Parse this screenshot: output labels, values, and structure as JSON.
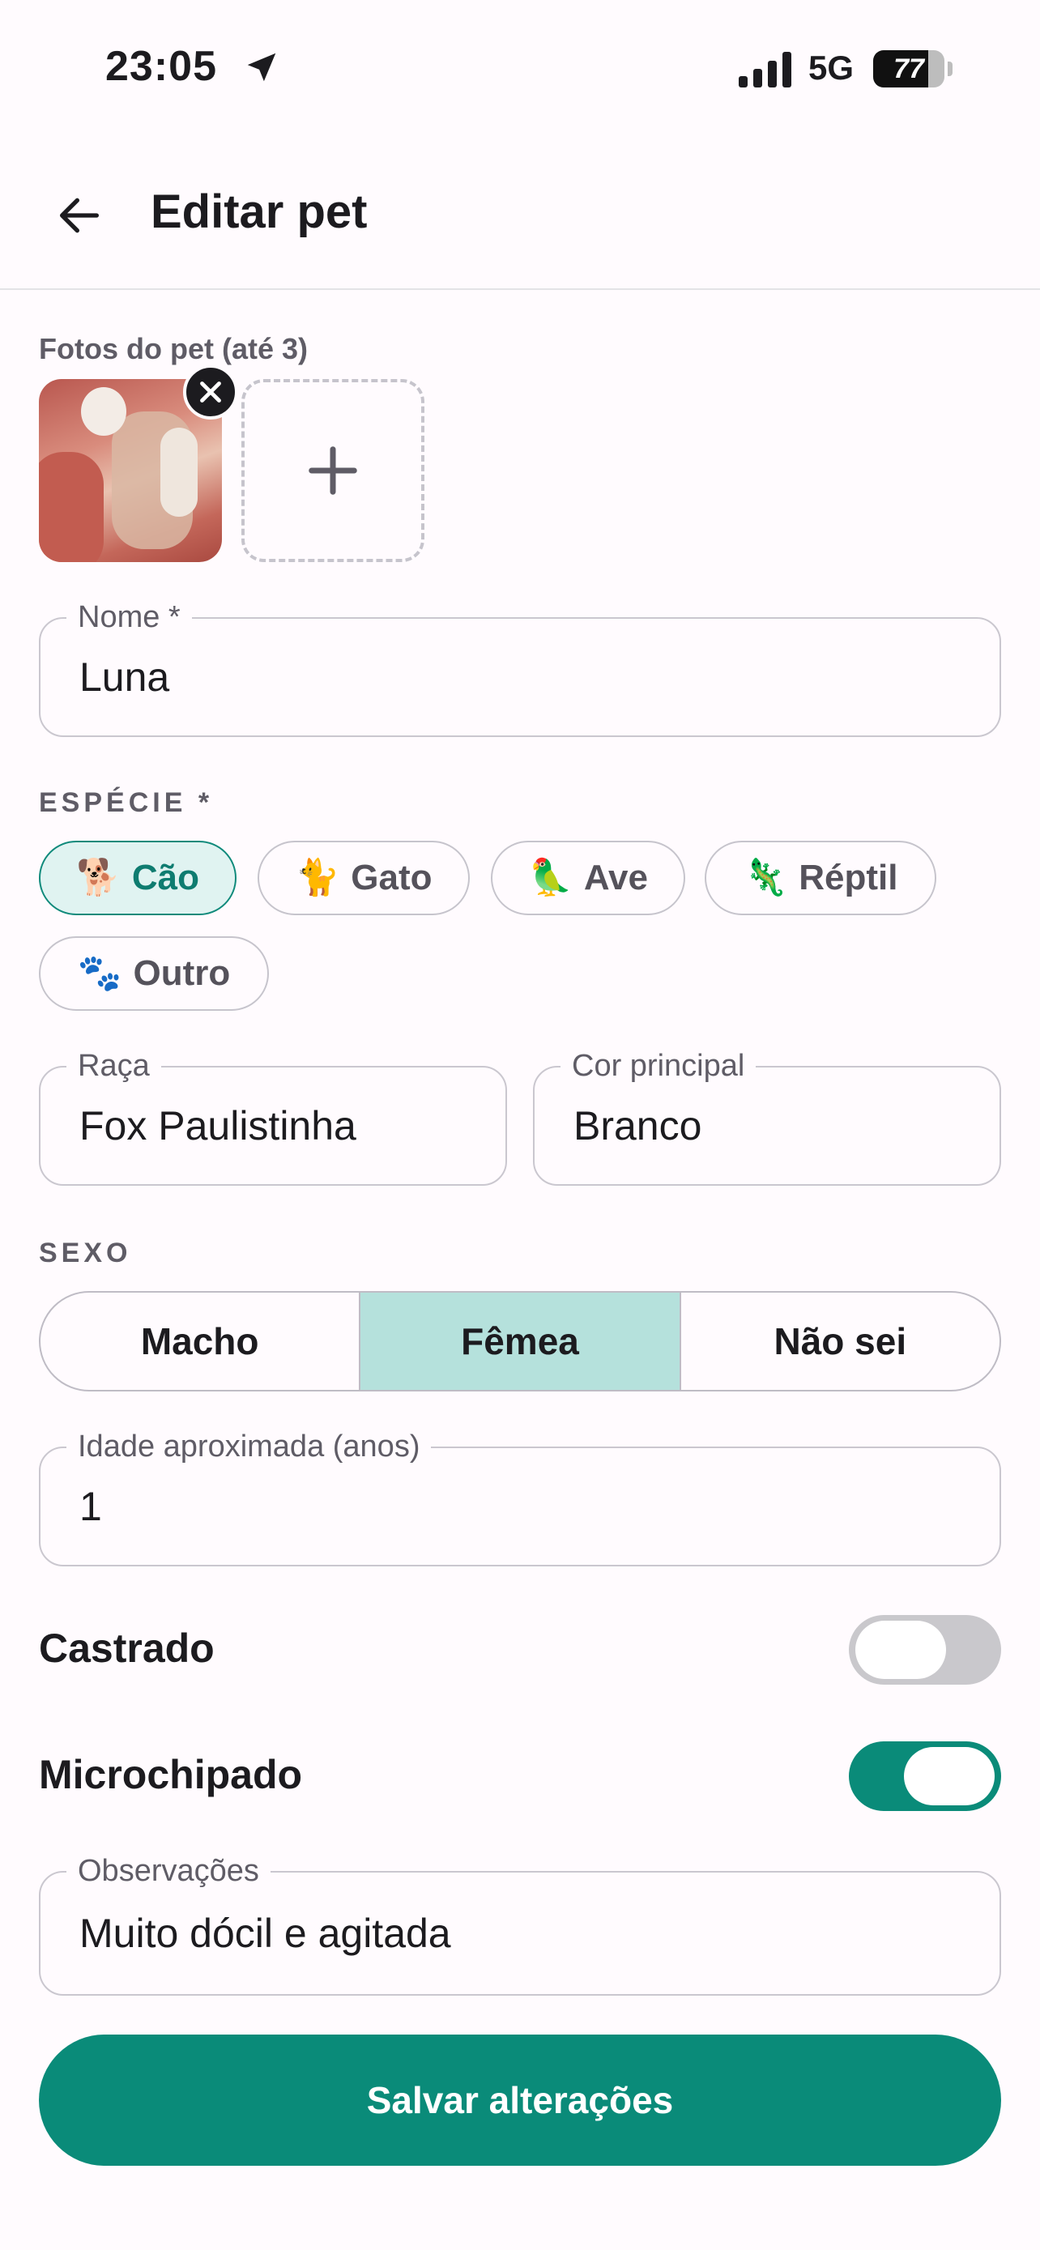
{
  "status_bar": {
    "time": "23:05",
    "network": "5G",
    "battery": 77,
    "battery_label": "77"
  },
  "app_bar": {
    "title": "Editar pet"
  },
  "photos": {
    "label": "Fotos do pet (até 3)",
    "count": 1
  },
  "form": {
    "name": {
      "label": "Nome *",
      "value": "Luna"
    },
    "species": {
      "label": "ESPÉCIE *",
      "options": [
        {
          "emoji": "🐕",
          "label": "Cão",
          "selected": true
        },
        {
          "emoji": "🐈",
          "label": "Gato",
          "selected": false
        },
        {
          "emoji": "🦜",
          "label": "Ave",
          "selected": false
        },
        {
          "emoji": "🦎",
          "label": "Réptil",
          "selected": false
        },
        {
          "emoji": "🐾",
          "label": "Outro",
          "selected": false
        }
      ]
    },
    "breed": {
      "label": "Raça",
      "value": "Fox Paulistinha"
    },
    "color": {
      "label": "Cor principal",
      "value": "Branco"
    },
    "sex": {
      "label": "SEXO",
      "options": [
        "Macho",
        "Fêmea",
        "Não sei"
      ],
      "selected": "Fêmea"
    },
    "age": {
      "label": "Idade aproximada (anos)",
      "value": "1"
    },
    "neutered": {
      "label": "Castrado",
      "on": false
    },
    "microchipped": {
      "label": "Microchipado",
      "on": true
    },
    "notes": {
      "label": "Observações",
      "value": "Muito dócil e agitada"
    }
  },
  "save_label": "Salvar alterações",
  "colors": {
    "accent": "#0a8b79",
    "accent_light": "#b5e1dc",
    "chip_active_bg": "#e0f3f1",
    "background": "#fffbfe"
  },
  "icons": {
    "back": "arrow-left-icon",
    "remove_photo": "close-icon",
    "add_photo": "plus-icon",
    "location": "location-arrow-icon",
    "signal": "signal-bars-icon",
    "battery": "battery-icon"
  }
}
